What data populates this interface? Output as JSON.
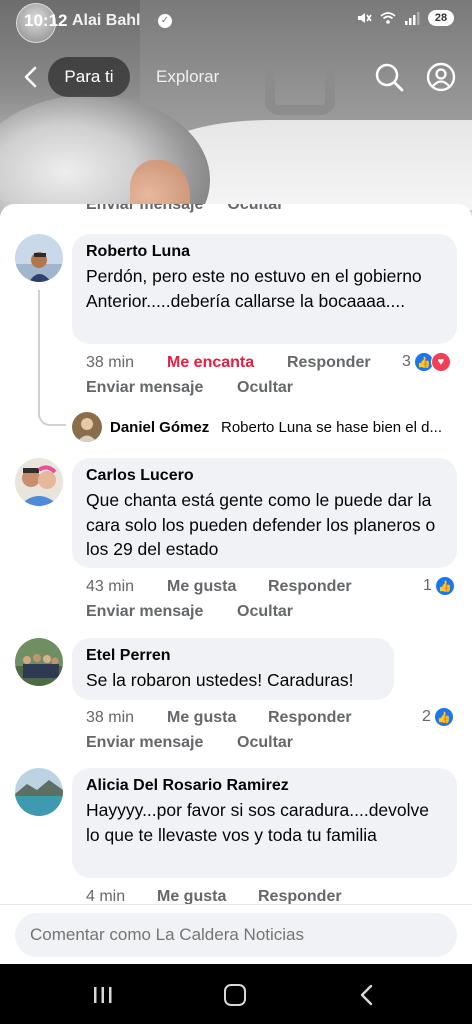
{
  "status_bar": {
    "time": "10:12",
    "overlay_name": "Alai Bahl",
    "battery": "28"
  },
  "top_nav": {
    "tab_active": "Para ti",
    "tab_other": "Explorar"
  },
  "cut_actions": {
    "send": "Enviar mensaje",
    "hide": "Ocultar"
  },
  "comments": [
    {
      "author": "Roberto Luna",
      "text": "Perdón, pero este no estuvo en el gobierno Anterior.....debería callarse la bocaaaa....",
      "time": "38 min",
      "react_label": "Me encanta",
      "reply_label": "Responder",
      "reactions": "3",
      "send": "Enviar mensaje",
      "hide": "Ocultar"
    },
    {
      "author": "Carlos Lucero",
      "text": "Que chanta está gente como le puede dar la cara solo los pueden defender los planeros o los 29 del estado",
      "time": "43 min",
      "react_label": "Me gusta",
      "reply_label": "Responder",
      "reactions": "1",
      "send": "Enviar mensaje",
      "hide": "Ocultar"
    },
    {
      "author": "Etel Perren",
      "text": "Se la robaron ustedes! Caraduras!",
      "time": "38 min",
      "react_label": "Me gusta",
      "reply_label": "Responder",
      "reactions": "2",
      "send": "Enviar mensaje",
      "hide": "Ocultar"
    },
    {
      "author": "Alicia Del Rosario Ramirez",
      "text": "Hayyyy...por favor si sos caradura....devolve lo que te llevaste vos y toda tu familia",
      "time": "4 min",
      "react_label": "Me gusta",
      "reply_label": "Responder"
    }
  ],
  "reply": {
    "author": "Daniel Gómez",
    "text": "Roberto Luna se hase bien el d..."
  },
  "comment_box": {
    "placeholder": "Comentar como La Caldera Noticias"
  },
  "colors": {
    "accent_blue": "#1877f2",
    "love_red": "#e41e3f",
    "bubble_bg": "#f0f2f5"
  },
  "icons": [
    "back-icon",
    "search-icon",
    "profile-icon",
    "like-icon",
    "love-icon",
    "recents-icon",
    "home-icon",
    "nav-back-icon"
  ]
}
